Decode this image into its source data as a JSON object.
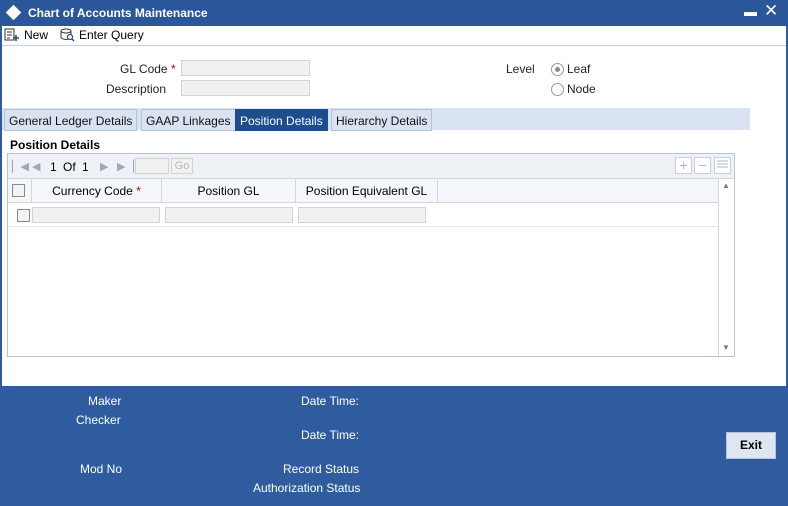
{
  "window": {
    "title": "Chart of Accounts Maintenance",
    "minimize_label": "▬",
    "close_label": "✕"
  },
  "toolbar": {
    "new_label": "New",
    "enter_query_label": "Enter Query"
  },
  "form": {
    "gl_code_label": "GL Code",
    "gl_code_value": "",
    "description_label": "Description",
    "description_value": "",
    "required_mark": "*",
    "level_label": "Level",
    "level_options": [
      "Leaf",
      "Node"
    ],
    "level_selected": "Leaf"
  },
  "tabs": [
    {
      "label": "General Ledger Details",
      "active": false
    },
    {
      "label": "GAAP Linkages",
      "active": false
    },
    {
      "label": "Position Details",
      "active": true
    },
    {
      "label": "Hierarchy Details",
      "active": false
    }
  ],
  "position_details": {
    "section_title": "Position Details",
    "pagination": {
      "current_page": "1",
      "of_label": "Of",
      "total_pages": "1",
      "go_label": "Go"
    },
    "columns": [
      "Currency Code",
      "Position GL",
      "Position Equivalent GL"
    ],
    "required_mark": "*",
    "rows": [
      {
        "currency_code": "",
        "position_gl": "",
        "position_equivalent_gl": ""
      }
    ]
  },
  "footer": {
    "maker_label": "Maker",
    "checker_label": "Checker",
    "date_time_label": "Date Time:",
    "mod_no_label": "Mod No",
    "record_status_label": "Record Status",
    "authorization_status_label": "Authorization Status",
    "exit_label": "Exit"
  },
  "colors": {
    "chrome_blue": "#2e5c9e",
    "active_tab": "#1d4d8c",
    "tab_bar": "#d8e2f1",
    "required": "#cc0000"
  }
}
